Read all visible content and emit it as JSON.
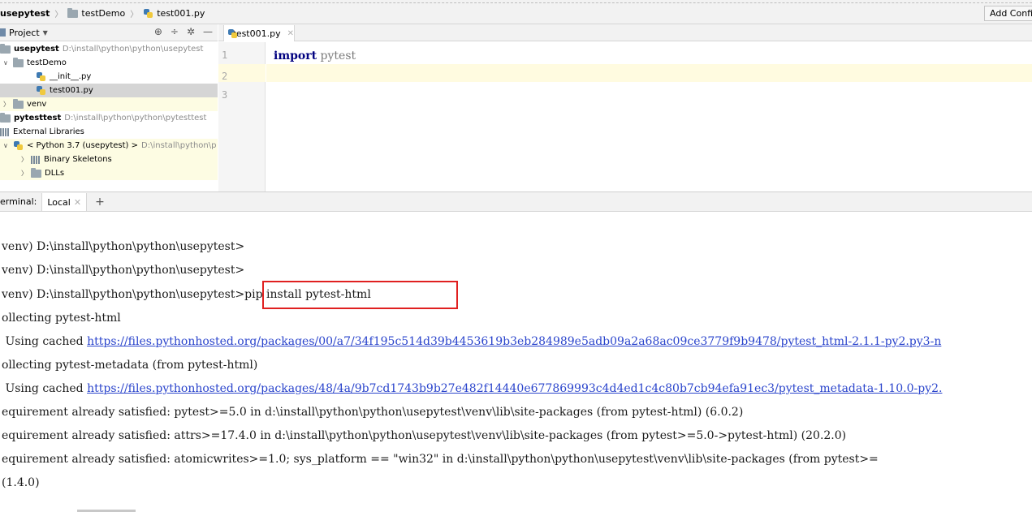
{
  "breadcrumb": {
    "items": [
      "usepytest",
      "testDemo",
      "test001.py"
    ],
    "icons": [
      "none",
      "folder-icon",
      "python-file-icon"
    ]
  },
  "toolbar": {
    "add_config_label": "Add Confi"
  },
  "project_panel": {
    "title": "Project",
    "tools": [
      "⊕",
      "÷",
      "✲",
      "—"
    ]
  },
  "tree": [
    {
      "label": "usepytest",
      "path": "D:\\install\\python\\python\\usepytest",
      "icon": "folder-icon",
      "expanded": true,
      "bold": true
    },
    {
      "label": "testDemo",
      "path": "",
      "icon": "folder-icon",
      "expanded": true
    },
    {
      "label": "__init__.py",
      "path": "",
      "icon": "python-file-icon"
    },
    {
      "label": "test001.py",
      "path": "",
      "icon": "python-file-icon",
      "selected": true
    },
    {
      "label": "venv",
      "path": "",
      "icon": "folder-icon",
      "expanded": false
    },
    {
      "label": "pytesttest",
      "path": "D:\\install\\python\\python\\pytesttest",
      "icon": "folder-icon",
      "bold": true
    },
    {
      "label": "External Libraries",
      "path": "",
      "icon": "library-icon"
    },
    {
      "label": "< Python 3.7 (usepytest) >",
      "path": "D:\\install\\python\\p",
      "icon": "python-sdk-icon",
      "expanded": true
    },
    {
      "label": "Binary Skeletons",
      "path": "",
      "icon": "library-icon",
      "expanded": false
    },
    {
      "label": "DLLs",
      "path": "",
      "icon": "folder-icon",
      "expanded": false
    }
  ],
  "editor": {
    "tab_label": "test001.py",
    "line_numbers": [
      "1",
      "2",
      "3"
    ],
    "code": {
      "keyword": "import",
      "module": " pytest"
    }
  },
  "terminal": {
    "label": "erminal:",
    "tab_label": "Local",
    "lines": [
      "venv) D:\\install\\python\\python\\usepytest>",
      "venv) D:\\install\\python\\python\\usepytest>",
      "venv) D:\\install\\python\\python\\usepytest>pip install pytest-html",
      "ollecting pytest-html",
      " Using cached ",
      "ollecting pytest-metadata (from pytest-html)",
      " Using cached ",
      "equirement already satisfied: pytest>=5.0 in d:\\install\\python\\python\\usepytest\\venv\\lib\\site-packages (from pytest-html) (6.0.2)",
      "equirement already satisfied: attrs>=17.4.0 in d:\\install\\python\\python\\usepytest\\venv\\lib\\site-packages (from pytest>=5.0->pytest-html) (20.2.0)",
      "equirement already satisfied: atomicwrites>=1.0; sys_platform == \"win32\" in d:\\install\\python\\python\\usepytest\\venv\\lib\\site-packages (from pytest>=",
      "(1.4.0)"
    ],
    "links": {
      "line5": "https://files.pythonhosted.org/packages/00/a7/34f195c514d39b4453619b3eb284989e5adb09a2a68ac09ce3779f9b9478/pytest_html-2.1.1-py2.py3-n",
      "line7": "https://files.pythonhosted.org/packages/48/4a/9b7cd1743b9b27e482f14440e677869993c4d4ed1c4c80b7cb94efa91ec3/pytest_metadata-1.10.0-py2."
    }
  },
  "colors": {
    "highlight_box": "#e02020",
    "link": "#2a44cc",
    "current_line": "#fffbe0"
  }
}
